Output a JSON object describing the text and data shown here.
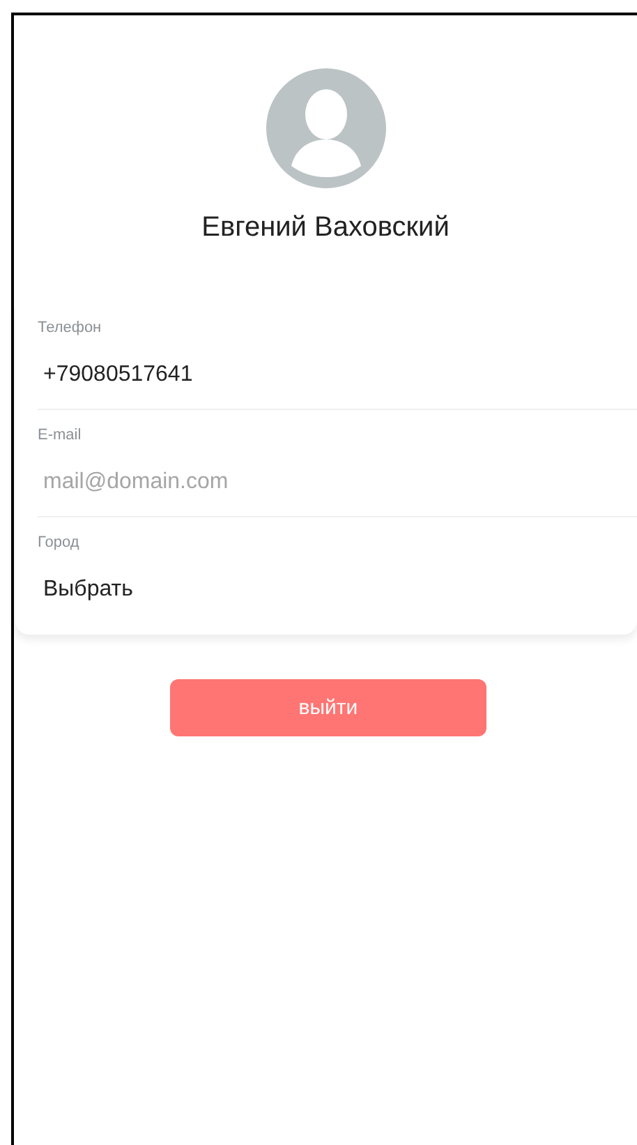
{
  "profile": {
    "name": "Евгений Ваховский"
  },
  "fields": [
    {
      "kind": "input",
      "label": "Телефон",
      "value": "+79080517641"
    },
    {
      "kind": "input",
      "label": "E-mail",
      "placeholder": "mail@domain.com"
    },
    {
      "kind": "select",
      "label": "Город",
      "value": "Выбрать"
    }
  ],
  "logout_button": {
    "label": "выйти"
  }
}
